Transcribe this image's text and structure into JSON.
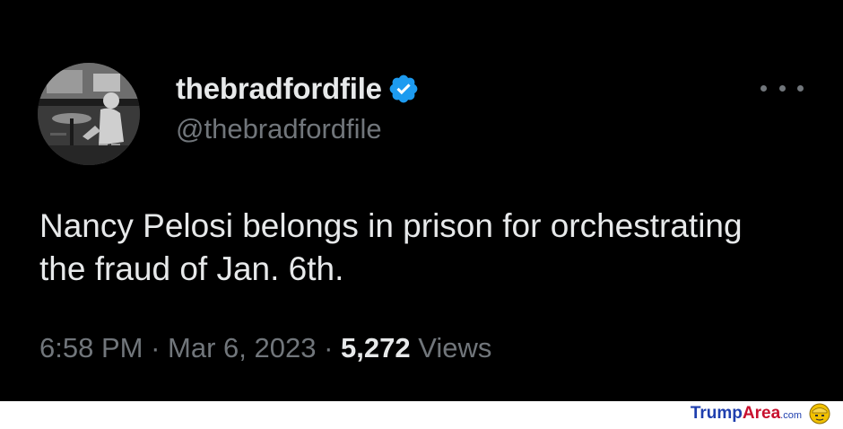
{
  "tweet": {
    "display_name": "thebradfordfile",
    "handle": "@thebradfordfile",
    "verified_icon": "verified-badge-icon",
    "more_icon": "more-horizontal-icon",
    "text": "Nancy Pelosi belongs in prison for orchestrating the fraud of Jan. 6th.",
    "time": "6:58 PM",
    "separator": "·",
    "date": "Mar 6, 2023",
    "views_count": "5,272",
    "views_label": "Views"
  },
  "watermark": {
    "part1": "Trump",
    "part2": "Area",
    "part3": ".com"
  },
  "colors": {
    "background": "#000000",
    "primary_text": "#e7e9ea",
    "secondary_text": "#71767b",
    "verified_blue": "#1d9bf0"
  }
}
